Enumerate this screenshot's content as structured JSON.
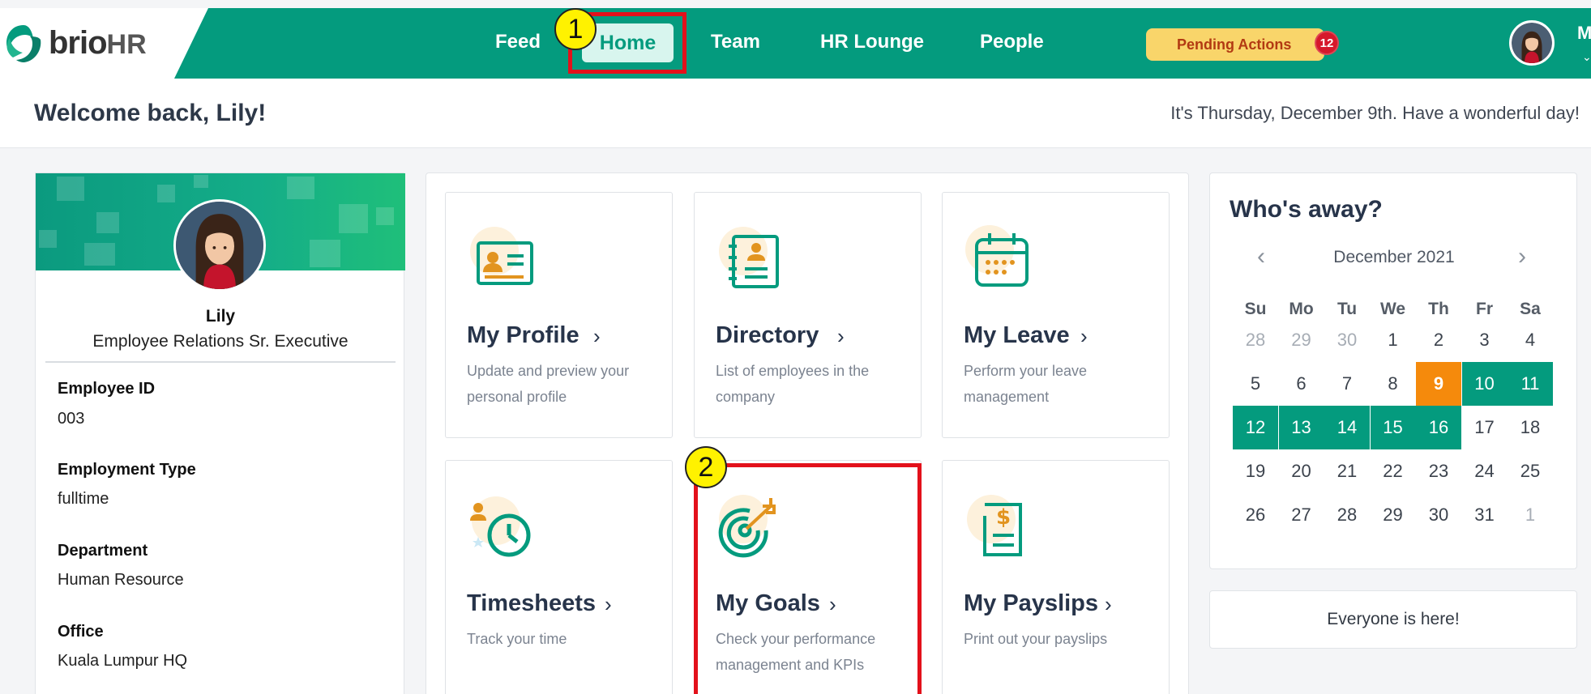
{
  "header": {
    "logo_brand": "brio",
    "logo_suffix": "HR",
    "nav": [
      {
        "label": "Feed"
      },
      {
        "label": "Home"
      },
      {
        "label": "Team"
      },
      {
        "label": "HR Lounge"
      },
      {
        "label": "People"
      }
    ],
    "active_nav": "Home",
    "pending_label": "Pending Actions",
    "pending_count": "12",
    "user_initial": "M",
    "user_caret": "⌄",
    "icons": [
      "logo-swirl-icon",
      "user-avatar-icon",
      "chevron-down-icon"
    ]
  },
  "welcome": {
    "title": "Welcome back, Lily!",
    "date_text": "It's Thursday, December 9th. Have a wonderful day!"
  },
  "profile": {
    "name": "Lily",
    "role": "Employee Relations Sr. Executive",
    "fields": [
      {
        "label": "Employee ID",
        "value": "003"
      },
      {
        "label": "Employment Type",
        "value": "fulltime"
      },
      {
        "label": "Department",
        "value": "Human Resource"
      },
      {
        "label": "Office",
        "value": "Kuala Lumpur HQ"
      }
    ]
  },
  "tiles": [
    {
      "title": "My Profile",
      "desc": "Update and preview your personal profile",
      "icon": "profile-card-icon"
    },
    {
      "title": "Directory",
      "desc": "List of employees in the company",
      "icon": "directory-book-icon"
    },
    {
      "title": "My Leave",
      "desc": "Perform your leave management",
      "icon": "calendar-icon"
    },
    {
      "title": "Timesheets",
      "desc": "Track your time",
      "icon": "clock-icon"
    },
    {
      "title": "My Goals",
      "desc": "Check your performance management and KPIs",
      "icon": "target-icon"
    },
    {
      "title": "My Payslips",
      "desc": "Print out your payslips",
      "icon": "payslip-icon"
    }
  ],
  "tile_chevron": "›",
  "calendar": {
    "title": "Who's away?",
    "month": "December 2021",
    "prev": "‹",
    "next": "›",
    "weekdays": [
      "Su",
      "Mo",
      "Tu",
      "We",
      "Th",
      "Fr",
      "Sa"
    ],
    "weeks": [
      [
        "28",
        "29",
        "30",
        "1",
        "2",
        "3",
        "4"
      ],
      [
        "5",
        "6",
        "7",
        "8",
        "9",
        "10",
        "11"
      ],
      [
        "12",
        "13",
        "14",
        "15",
        "16",
        "17",
        "18"
      ],
      [
        "19",
        "20",
        "21",
        "22",
        "23",
        "24",
        "25"
      ],
      [
        "26",
        "27",
        "28",
        "29",
        "30",
        "31",
        "1"
      ]
    ],
    "dim_days": [
      "0-0",
      "0-1",
      "0-2",
      "4-6"
    ],
    "away_days": [
      "1-5",
      "1-6",
      "2-0",
      "2-1",
      "2-2",
      "2-3",
      "2-4"
    ],
    "today": "1-4"
  },
  "everyone_text": "Everyone is here!",
  "annotations": [
    {
      "number": "1",
      "target": "Home"
    },
    {
      "number": "2",
      "target": "My Goals"
    }
  ],
  "colors": {
    "brand_teal": "#049b7e",
    "today_orange": "#f58a0c",
    "pending_yellow": "#f9d56a",
    "badge_red": "#d6182b",
    "highlight_red": "#e3111b",
    "marker_yellow": "#fff200"
  }
}
